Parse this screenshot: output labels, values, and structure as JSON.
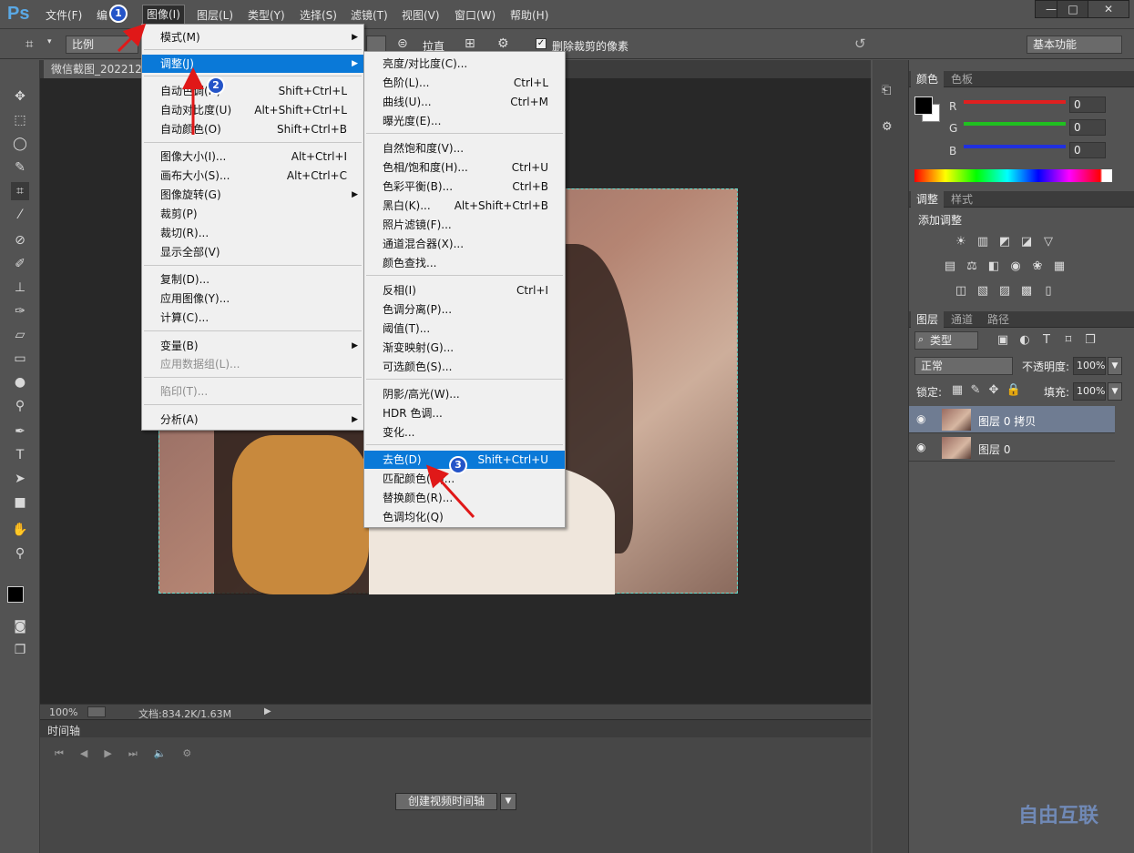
{
  "app": {
    "logo": "Ps"
  },
  "menubar": {
    "items": [
      "文件(F)",
      "编",
      "图像(I)",
      "图层(L)",
      "类型(Y)",
      "选择(S)",
      "滤镜(T)",
      "视图(V)",
      "窗口(W)",
      "帮助(H)"
    ],
    "window_controls": [
      "—",
      "□",
      "✕"
    ]
  },
  "options_bar": {
    "ratio_select": "比例",
    "straighten_label": "拉直",
    "delete_cropped_checkbox": "删除裁剪的像素",
    "workspace_select": "基本功能"
  },
  "document": {
    "tab_title": "微信截图_202212"
  },
  "status": {
    "zoom": "100%",
    "doc_size": "文档:834.2K/1.63M"
  },
  "timeline": {
    "title": "时间轴",
    "create_button": "创建视频时间轴"
  },
  "image_menu": {
    "items": [
      {
        "label": "模式(M)",
        "shortcut": "",
        "submenu": true
      },
      {
        "label": "调整(J)",
        "shortcut": "",
        "submenu": true,
        "highlight": true
      },
      {
        "label": "自动色调(N)",
        "shortcut": "Shift+Ctrl+L"
      },
      {
        "label": "自动对比度(U)",
        "shortcut": "Alt+Shift+Ctrl+L"
      },
      {
        "label": "自动颜色(O)",
        "shortcut": "Shift+Ctrl+B"
      },
      {
        "label": "图像大小(I)...",
        "shortcut": "Alt+Ctrl+I"
      },
      {
        "label": "画布大小(S)...",
        "shortcut": "Alt+Ctrl+C"
      },
      {
        "label": "图像旋转(G)",
        "shortcut": "",
        "submenu": true
      },
      {
        "label": "裁剪(P)",
        "shortcut": ""
      },
      {
        "label": "裁切(R)...",
        "shortcut": ""
      },
      {
        "label": "显示全部(V)",
        "shortcut": ""
      },
      {
        "label": "复制(D)...",
        "shortcut": ""
      },
      {
        "label": "应用图像(Y)...",
        "shortcut": ""
      },
      {
        "label": "计算(C)...",
        "shortcut": ""
      },
      {
        "label": "变量(B)",
        "shortcut": "",
        "submenu": true
      },
      {
        "label": "应用数据组(L)...",
        "shortcut": "",
        "disabled": true
      },
      {
        "label": "陷印(T)...",
        "shortcut": "",
        "disabled": true
      },
      {
        "label": "分析(A)",
        "shortcut": "",
        "submenu": true
      }
    ]
  },
  "adjust_submenu": {
    "items": [
      {
        "label": "亮度/对比度(C)...",
        "shortcut": ""
      },
      {
        "label": "色阶(L)...",
        "shortcut": "Ctrl+L"
      },
      {
        "label": "曲线(U)...",
        "shortcut": "Ctrl+M"
      },
      {
        "label": "曝光度(E)...",
        "shortcut": ""
      },
      {
        "label": "自然饱和度(V)...",
        "shortcut": ""
      },
      {
        "label": "色相/饱和度(H)...",
        "shortcut": "Ctrl+U"
      },
      {
        "label": "色彩平衡(B)...",
        "shortcut": "Ctrl+B"
      },
      {
        "label": "黑白(K)...",
        "shortcut": "Alt+Shift+Ctrl+B"
      },
      {
        "label": "照片滤镜(F)...",
        "shortcut": ""
      },
      {
        "label": "通道混合器(X)...",
        "shortcut": ""
      },
      {
        "label": "颜色查找...",
        "shortcut": ""
      },
      {
        "label": "反相(I)",
        "shortcut": "Ctrl+I"
      },
      {
        "label": "色调分离(P)...",
        "shortcut": ""
      },
      {
        "label": "阈值(T)...",
        "shortcut": ""
      },
      {
        "label": "渐变映射(G)...",
        "shortcut": ""
      },
      {
        "label": "可选颜色(S)...",
        "shortcut": ""
      },
      {
        "label": "阴影/高光(W)...",
        "shortcut": ""
      },
      {
        "label": "HDR 色调...",
        "shortcut": ""
      },
      {
        "label": "变化...",
        "shortcut": ""
      },
      {
        "label": "去色(D)",
        "shortcut": "Shift+Ctrl+U",
        "highlight": true
      },
      {
        "label": "匹配颜色(M)...",
        "shortcut": ""
      },
      {
        "label": "替换颜色(R)...",
        "shortcut": ""
      },
      {
        "label": "色调均化(Q)",
        "shortcut": ""
      }
    ]
  },
  "badges": [
    "1",
    "2",
    "3"
  ],
  "color_panel": {
    "tabs": [
      "颜色",
      "色板"
    ],
    "channels": [
      {
        "label": "R",
        "value": "0",
        "color": "#e02020"
      },
      {
        "label": "G",
        "value": "0",
        "color": "#20c020"
      },
      {
        "label": "B",
        "value": "0",
        "color": "#2030e0"
      }
    ]
  },
  "adjustments_panel": {
    "tabs": [
      "调整",
      "样式"
    ],
    "title": "添加调整"
  },
  "layers_panel": {
    "tabs": [
      "图层",
      "通道",
      "路径"
    ],
    "filter": "类型",
    "blend_mode": "正常",
    "opacity_label": "不透明度:",
    "opacity_value": "100%",
    "lock_label": "锁定:",
    "fill_label": "填充:",
    "fill_value": "100%",
    "layers": [
      {
        "name": "图层 0 拷贝",
        "selected": true
      },
      {
        "name": "图层 0",
        "selected": false
      }
    ]
  },
  "watermark": "自由互联"
}
